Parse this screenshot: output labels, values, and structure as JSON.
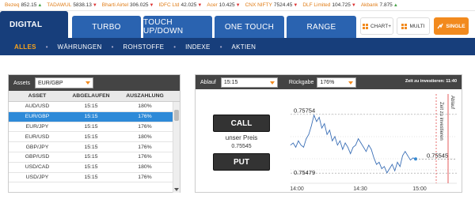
{
  "ticker": [
    {
      "name": "Bezeq",
      "value": "852.15",
      "dir": "up"
    },
    {
      "name": "TADAWUL",
      "value": "5838.13",
      "dir": "dn"
    },
    {
      "name": "Bharti Airtel",
      "value": "306.025",
      "dir": "dn"
    },
    {
      "name": "IDFC Ltd",
      "value": "42.025",
      "dir": "dn"
    },
    {
      "name": "Acer",
      "value": "10.425",
      "dir": "dn"
    },
    {
      "name": "CNX NIFTY",
      "value": "7524.45",
      "dir": "dn"
    },
    {
      "name": "DLF Limited",
      "value": "104.725",
      "dir": "dn"
    },
    {
      "name": "Akbank",
      "value": "7.875",
      "dir": "up"
    }
  ],
  "tabs": [
    "DIGITAL",
    "TURBO",
    "TOUCH UP/DOWN",
    "ONE TOUCH",
    "RANGE"
  ],
  "view_buttons": {
    "chart": "CHART+",
    "multi": "MULTI",
    "single": "SINGLE"
  },
  "subnav": [
    "ALLES",
    "WÄHRUNGEN",
    "ROHSTOFFE",
    "INDEXE",
    "AKTIEN"
  ],
  "asset_panel": {
    "assets_label": "Assets",
    "selected_asset": "EUR/GBP",
    "columns": [
      "ASSET",
      "ABGELAUFEN",
      "AUSZAHLUNG"
    ],
    "rows": [
      {
        "asset": "AUD/USD",
        "expiry": "15:15",
        "payout": "180%"
      },
      {
        "asset": "EUR/GBP",
        "expiry": "15:15",
        "payout": "176%"
      },
      {
        "asset": "EUR/JPY",
        "expiry": "15:15",
        "payout": "176%"
      },
      {
        "asset": "EUR/USD",
        "expiry": "15:15",
        "payout": "180%"
      },
      {
        "asset": "GBP/JPY",
        "expiry": "15:15",
        "payout": "176%"
      },
      {
        "asset": "GBP/USD",
        "expiry": "15:15",
        "payout": "176%"
      },
      {
        "asset": "USD/CAD",
        "expiry": "15:15",
        "payout": "180%"
      },
      {
        "asset": "USD/JPY",
        "expiry": "15:15",
        "payout": "176%"
      }
    ],
    "selected_index": 1
  },
  "trade_panel": {
    "expiry_label": "Ablauf",
    "expiry_value": "15:15",
    "return_label": "Rückgabe",
    "return_value": "176%",
    "invest_label": "Zeit zu investieren:",
    "invest_time": "11:40",
    "call_label": "CALL",
    "price_label": "unser Preis",
    "price_value": "0.75545",
    "put_label": "PUT"
  },
  "chart_data": {
    "type": "line",
    "high_label": "0.75754",
    "low_label": "0.75479",
    "current_label": "0.75545",
    "x_ticks": [
      "14:00",
      "14:30",
      "15:00"
    ],
    "vertical_labels": {
      "invest_line": "Zeit zu investieren",
      "expiry_line": "Ablauf"
    },
    "ylim": [
      0.7545,
      0.7579
    ],
    "points": [
      0.7561,
      0.7562,
      0.756,
      0.7563,
      0.7561,
      0.756,
      0.7564,
      0.7566,
      0.757,
      0.7575,
      0.7572,
      0.7574,
      0.7569,
      0.7571,
      0.7566,
      0.7568,
      0.7563,
      0.7565,
      0.7561,
      0.7563,
      0.7559,
      0.7562,
      0.756,
      0.7557,
      0.756,
      0.7561,
      0.7564,
      0.7562,
      0.756,
      0.7558,
      0.7561,
      0.7559,
      0.7555,
      0.7552,
      0.7553,
      0.755,
      0.7551,
      0.7548,
      0.755,
      0.7552,
      0.7549,
      0.7553,
      0.7551,
      0.7556,
      0.7558,
      0.7556,
      0.7554,
      0.7555,
      0.75545
    ]
  }
}
